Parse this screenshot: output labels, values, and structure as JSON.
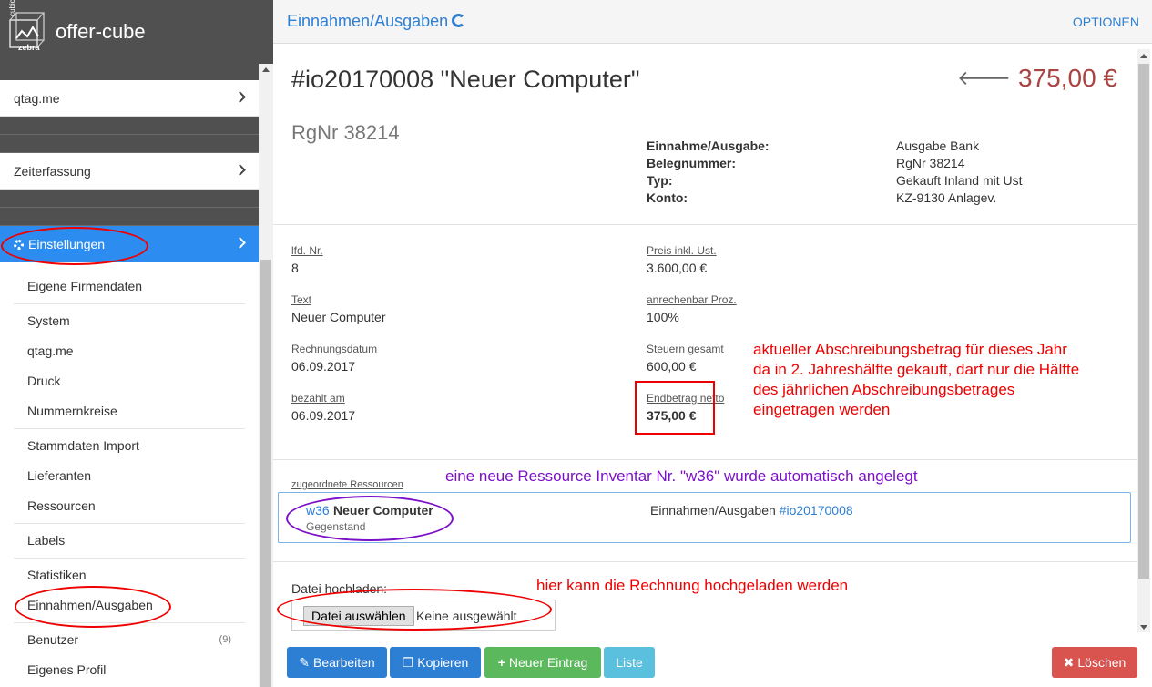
{
  "brand": {
    "name": "offer-cube",
    "logo_side_text": "cubic",
    "logo_sub_text": "zebra"
  },
  "sidebar": {
    "top_items": [
      {
        "label": "qtag.me"
      },
      {
        "label": "Zeiterfassung"
      },
      {
        "label": "Einstellungen"
      }
    ],
    "sub_items": [
      "Eigene Firmendaten",
      "System",
      "qtag.me",
      "Druck",
      "Nummernkreise",
      "Stammdaten Import",
      "Lieferanten",
      "Ressourcen",
      "Labels",
      "Statistiken",
      "Einnahmen/Ausgaben",
      "Benutzer",
      "Eigenes Profil"
    ],
    "benutzer_badge": "(9)"
  },
  "header": {
    "section": "Einnahmen/Ausgaben",
    "options": "OPTIONEN"
  },
  "document": {
    "title": "#io20170008 \"Neuer Computer\"",
    "amount": "375,00 €",
    "rgnr": "RgNr 38214",
    "meta": [
      {
        "k": "Einnahme/Ausgabe:",
        "v": "Ausgabe Bank"
      },
      {
        "k": "Belegnummer:",
        "v": "RgNr 38214"
      },
      {
        "k": "Typ:",
        "v": "Gekauft Inland mit Ust"
      },
      {
        "k": "Konto:",
        "v": "KZ-9130 Anlagev."
      }
    ],
    "fields": {
      "lfd_nr": {
        "label": "lfd. Nr.",
        "value": "8"
      },
      "text": {
        "label": "Text",
        "value": "Neuer Computer"
      },
      "rechnungsdatum": {
        "label": "Rechnungsdatum",
        "value": "06.09.2017"
      },
      "bezahlt_am": {
        "label": "bezahlt am",
        "value": "06.09.2017"
      },
      "preis": {
        "label": "Preis inkl. Ust.",
        "value": "3.600,00 €"
      },
      "anrechenbar": {
        "label": "anrechenbar Proz.",
        "value": "100%"
      },
      "steuern": {
        "label": "Steuern gesamt",
        "value": "600,00 €"
      },
      "endbetrag": {
        "label": "Endbetrag netto",
        "value": "375,00 €"
      }
    }
  },
  "resources": {
    "label": "zugeordnete Ressourcen",
    "id": "w36",
    "name": "Neuer Computer",
    "type": "Gegenstand",
    "link_text": "Einnahmen/Ausgaben",
    "link_id": "#io20170008"
  },
  "upload": {
    "label": "Datei hochladen:",
    "choose": "Datei auswählen",
    "none": "Keine ausgewählt"
  },
  "actions": {
    "edit": "Bearbeiten",
    "copy": "Kopieren",
    "new": "Neuer Eintrag",
    "list": "Liste",
    "delete": "Löschen"
  },
  "annotations": {
    "depreciation": [
      "aktueller Abschreibungsbetrag für dieses Jahr",
      "da in 2. Jahreshälfte gekauft, darf nur die Hälfte",
      "des jährlichen Abschreibungsbetrages",
      "eingetragen werden"
    ],
    "resource": "eine neue Ressource Inventar Nr. \"w36\" wurde automatisch angelegt",
    "upload": "hier kann die Rechnung hochgeladen werden"
  },
  "colors": {
    "accent": "#2d8cf0",
    "link": "#2d7fd3",
    "amount": "#a94442",
    "annotation_red": "#e00000",
    "annotation_purple": "#7b10c8"
  }
}
